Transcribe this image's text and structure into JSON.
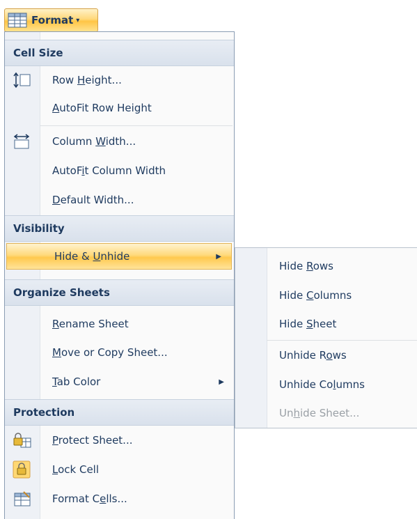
{
  "ribbon": {
    "button_label": "Format",
    "icon": "format-cells-icon"
  },
  "menu": {
    "sections": [
      {
        "header": "Cell Size",
        "items": [
          {
            "pre": "Row ",
            "u": "H",
            "post": "eight...",
            "icon": "row-height-icon"
          },
          {
            "pre": "",
            "u": "A",
            "post": "utoFit Row Height",
            "icon": ""
          },
          {
            "pre": "Column ",
            "u": "W",
            "post": "idth...",
            "icon": "column-width-icon"
          },
          {
            "pre": "AutoF",
            "u": "i",
            "post": "t Column Width",
            "icon": ""
          },
          {
            "pre": "",
            "u": "D",
            "post": "efault Width...",
            "icon": ""
          }
        ]
      },
      {
        "header": "Visibility",
        "items": [
          {
            "pre": "Hide & ",
            "u": "U",
            "post": "nhide",
            "icon": "",
            "submenu": true,
            "active": true
          }
        ]
      },
      {
        "header": "Organize Sheets",
        "items": [
          {
            "pre": "",
            "u": "R",
            "post": "ename Sheet",
            "icon": ""
          },
          {
            "pre": "",
            "u": "M",
            "post": "ove or Copy Sheet...",
            "icon": ""
          },
          {
            "pre": "",
            "u": "T",
            "post": "ab Color",
            "icon": "",
            "submenu": true
          }
        ]
      },
      {
        "header": "Protection",
        "items": [
          {
            "pre": "",
            "u": "P",
            "post": "rotect Sheet...",
            "icon": "protect-sheet-icon"
          },
          {
            "pre": "",
            "u": "L",
            "post": "ock Cell",
            "icon": "lock-cell-icon"
          },
          {
            "pre": "Format C",
            "u": "e",
            "post": "lls...",
            "icon": "format-cells-icon"
          }
        ]
      }
    ]
  },
  "submenu": {
    "items": [
      {
        "pre": "Hide ",
        "u": "R",
        "post": "ows",
        "disabled": false
      },
      {
        "pre": "Hide ",
        "u": "C",
        "post": "olumns",
        "disabled": false
      },
      {
        "pre": "Hide ",
        "u": "S",
        "post": "heet",
        "disabled": false
      },
      {
        "pre": "Unhide R",
        "u": "o",
        "post": "ws",
        "disabled": false
      },
      {
        "pre": "Unhide Co",
        "u": "l",
        "post": "umns",
        "disabled": false
      },
      {
        "pre": "Un",
        "u": "h",
        "post": "ide Sheet...",
        "disabled": true
      }
    ]
  }
}
